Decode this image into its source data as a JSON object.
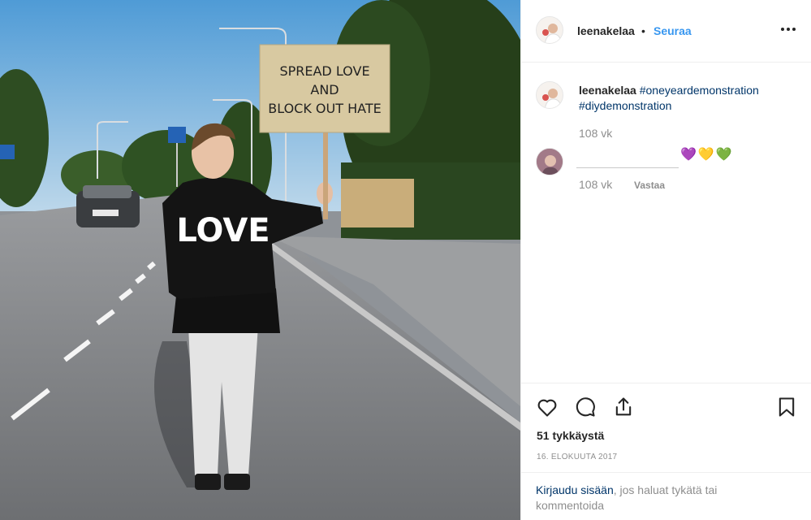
{
  "post": {
    "author": "leenakelaa",
    "separator": "•",
    "follow_label": "Seuraa",
    "more_icon": "more-options-icon",
    "photo": {
      "sign_line1": "SPREAD LOVE",
      "sign_line2": "AND",
      "sign_line3": "BLOCK OUT HATE",
      "sweater_text": "LOVE"
    }
  },
  "comments": [
    {
      "username": "leenakelaa",
      "hashtag1": "#oneyeardemonstration",
      "hashtag2": "#diydemonstration",
      "age": "108 vk"
    },
    {
      "emoji": "💜💛💚",
      "age": "108 vk",
      "reply_label": "Vastaa"
    }
  ],
  "actions": {
    "icons": [
      "heart-icon",
      "comment-icon",
      "share-icon",
      "bookmark-icon"
    ],
    "likes": "51 tykkäystä",
    "date": "16. ELOKUUTA 2017"
  },
  "login": {
    "link": "Kirjaudu sisään",
    "rest": ", jos haluat tykätä tai kommentoida"
  },
  "colors": {
    "link_blue": "#3897f0",
    "hashtag_blue": "#003569",
    "muted": "#8e8e8e",
    "text": "#262626"
  }
}
